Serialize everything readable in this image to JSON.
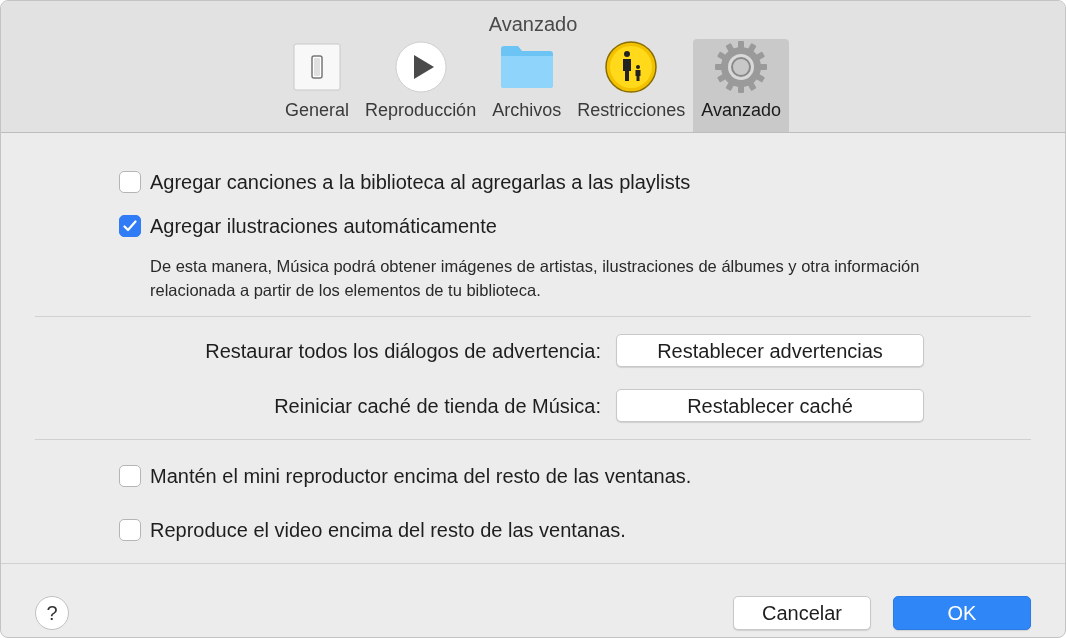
{
  "window": {
    "title": "Avanzado"
  },
  "tabs": [
    {
      "label": "General",
      "kind": "switch",
      "selected": false
    },
    {
      "label": "Reproducción",
      "kind": "play",
      "selected": false
    },
    {
      "label": "Archivos",
      "kind": "folder",
      "selected": false
    },
    {
      "label": "Restricciones",
      "kind": "parental",
      "selected": false
    },
    {
      "label": "Avanzado",
      "kind": "gear",
      "selected": true
    }
  ],
  "options_top": [
    {
      "label": "Agregar canciones a la biblioteca al agregarlas a las playlists",
      "checked": false
    },
    {
      "label": "Agregar ilustraciones automáticamente",
      "checked": true
    }
  ],
  "description": "De esta manera, Música podrá obtener imágenes de artistas, ilustraciones de álbumes y otra información relacionada a partir de los elementos de tu biblioteca.",
  "actions": [
    {
      "label": "Restaurar todos los diálogos de advertencia:",
      "button": "Restablecer advertencias"
    },
    {
      "label": "Reiniciar caché de tienda de Música:",
      "button": "Restablecer caché"
    }
  ],
  "options_bottom": [
    {
      "label": "Mantén el mini reproductor encima del resto de las ventanas.",
      "checked": false
    },
    {
      "label": "Reproduce el video encima del resto de las ventanas.",
      "checked": false
    }
  ],
  "help_button": "?",
  "buttons": [
    {
      "label": "Cancelar",
      "kind": "secondary"
    },
    {
      "label": "OK",
      "kind": "default"
    }
  ]
}
